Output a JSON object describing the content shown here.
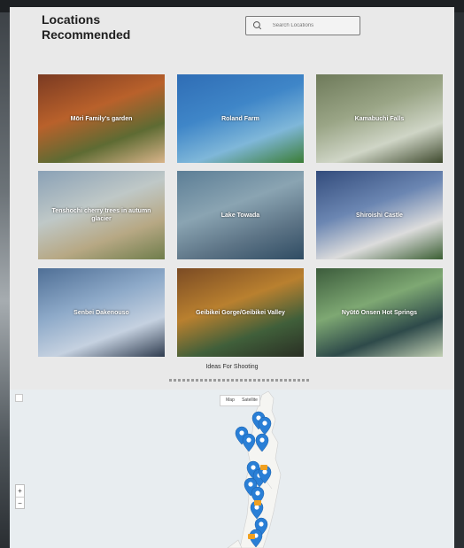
{
  "header": {
    "title_line1": "Locations",
    "title_line2": "Recommended",
    "search_placeholder": "Search Locations"
  },
  "locations": [
    {
      "name": "Mōri Family's garden",
      "colors": [
        "#7a3a22",
        "#b9612b",
        "#5e6b33",
        "#d9b48a"
      ]
    },
    {
      "name": "Roland Farm",
      "colors": [
        "#2f6db5",
        "#3f86c8",
        "#7fb7d9",
        "#3b7d36"
      ]
    },
    {
      "name": "Kamabuchi Falls",
      "colors": [
        "#6e7a5a",
        "#9aa586",
        "#cfd5c6",
        "#3f4a2e"
      ]
    },
    {
      "name": "Tenshochi cherry trees in autumn glacier",
      "colors": [
        "#8aa1b6",
        "#bfc8c7",
        "#b7a884",
        "#6f7d4b"
      ]
    },
    {
      "name": "Lake Towada",
      "colors": [
        "#5c7e96",
        "#8aa4b2",
        "#5d7486",
        "#2f4c63"
      ]
    },
    {
      "name": "Shiroishi Castle",
      "colors": [
        "#334c7c",
        "#6b86b2",
        "#dcdcdc",
        "#3b5f33"
      ]
    },
    {
      "name": "Senbei Dakenouso",
      "colors": [
        "#4f6f96",
        "#8eaac9",
        "#c5d1e0",
        "#2f3c4f"
      ]
    },
    {
      "name": "Geibikei Gorge/Geibikei Valley",
      "colors": [
        "#7b4b24",
        "#b9802f",
        "#405f3a",
        "#2a2f24"
      ]
    },
    {
      "name": "Nyūtō Onsen Hot Springs",
      "colors": [
        "#3c5c3c",
        "#7ea873",
        "#2e4a4a",
        "#c2d0b4"
      ]
    }
  ],
  "footer": {
    "title": "Ideas For Shooting"
  },
  "map": {
    "type_options": [
      "Map",
      "Satellite"
    ],
    "zoom_in": "+",
    "zoom_out": "−",
    "pin_color": "#2a7fd6",
    "marker_color": "#f0a020"
  }
}
